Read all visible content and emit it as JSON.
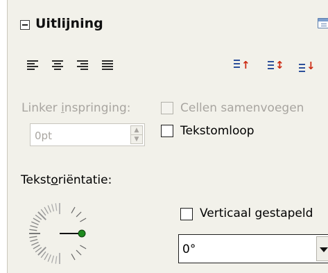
{
  "panel": {
    "title": "Uitlijning",
    "collapse_icon": "minus-box-icon",
    "dock_icon": "panel-dock-icon"
  },
  "horizontal_alignment": [
    {
      "name": "align-left",
      "icon": "align-left-icon"
    },
    {
      "name": "align-center",
      "icon": "align-center-icon"
    },
    {
      "name": "align-right",
      "icon": "align-right-icon"
    },
    {
      "name": "align-justify",
      "icon": "align-justify-icon"
    }
  ],
  "vertical_alignment": [
    {
      "name": "valign-top",
      "icon": "valign-top-icon"
    },
    {
      "name": "valign-center",
      "icon": "valign-center-icon"
    },
    {
      "name": "valign-bottom",
      "icon": "valign-bottom-icon"
    }
  ],
  "indent": {
    "label_prefix": "Linker ",
    "label_mnemonic": "i",
    "label_suffix": "nspringing:",
    "value": "0pt",
    "enabled": false
  },
  "merge_cells": {
    "label": "Cellen samenvoegen",
    "checked": false,
    "enabled": false
  },
  "wrap_text": {
    "label": "Tekstomloop",
    "checked": false
  },
  "orientation": {
    "label_prefix": "Tekst",
    "label_mnemonic": "o",
    "label_suffix": "riëntatie:",
    "angle_degrees": 0
  },
  "stacked_vertical": {
    "label": "Verticaal gestapeld",
    "checked": false
  },
  "rotation_select": {
    "value": "0°"
  },
  "colors": {
    "panel_bg": "#f2f1ea",
    "disabled_text": "#a8a5a0",
    "dial_dot": "#1e8a1e",
    "valign_arrow": "#cc2a12",
    "valign_bars": "#2c4f9a"
  }
}
